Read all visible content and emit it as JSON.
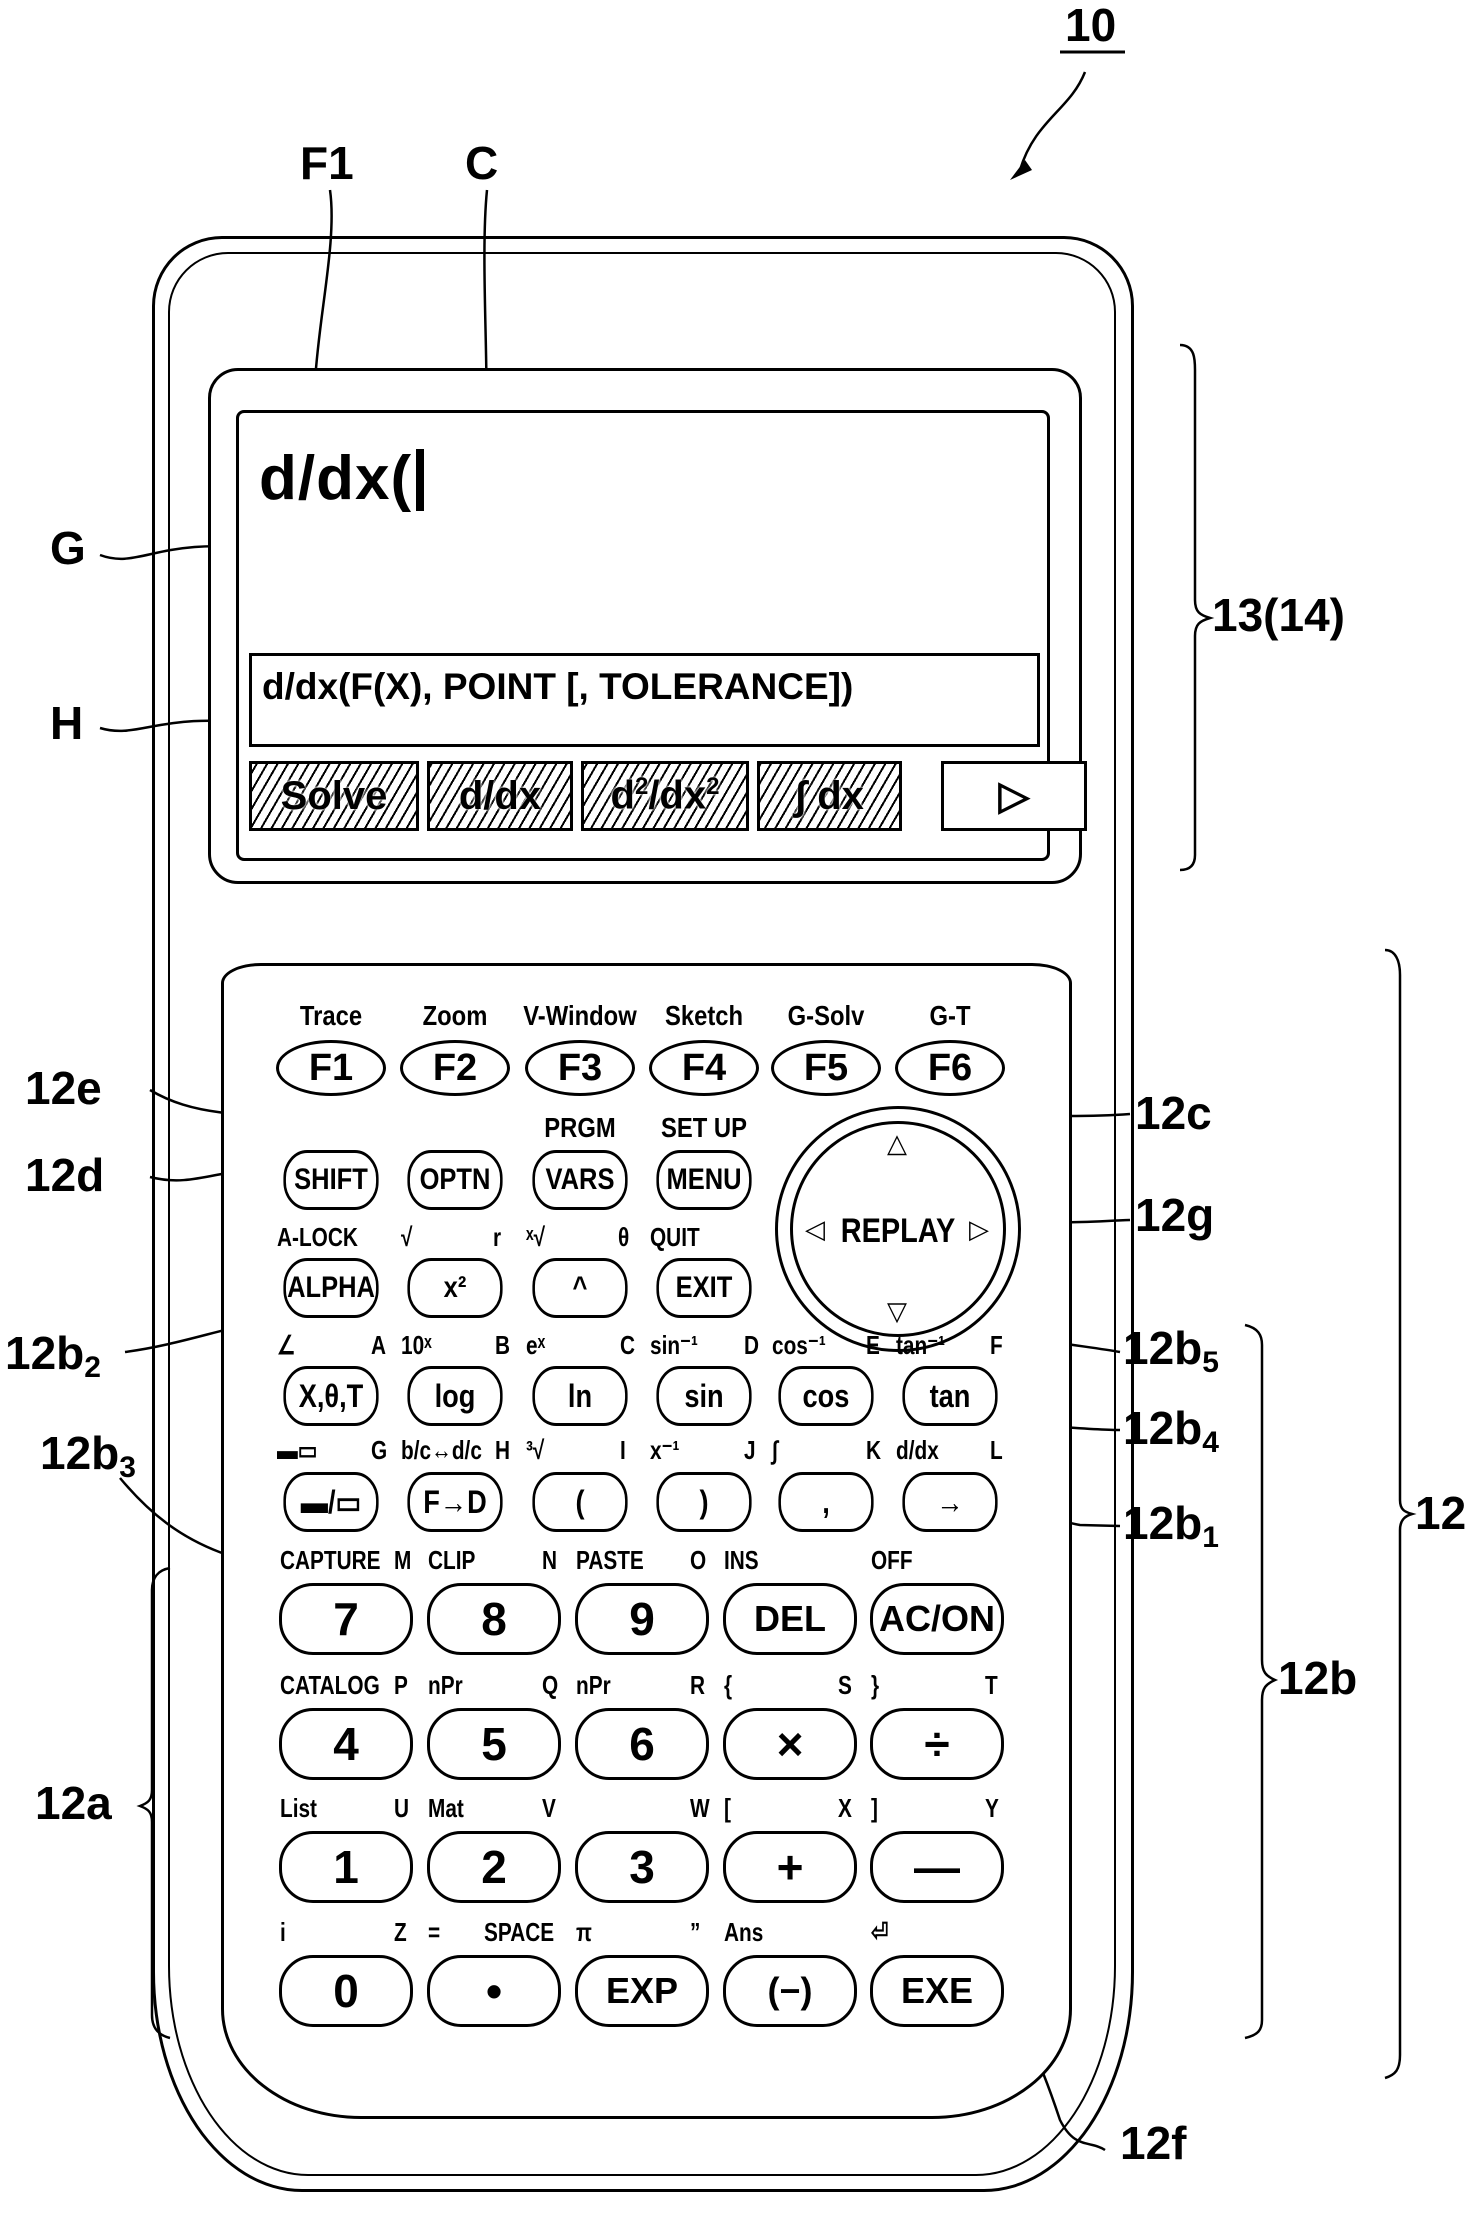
{
  "figure_refs": {
    "device": "10",
    "f1": "F1",
    "c": "C",
    "g": "G",
    "h": "H",
    "display": "13(14)",
    "keypad": "12",
    "r12a": "12a",
    "r12b": "12b",
    "r12b1": {
      "base": "12b",
      "sub": "1"
    },
    "r12b2": {
      "base": "12b",
      "sub": "2"
    },
    "r12b3": {
      "base": "12b",
      "sub": "3"
    },
    "r12b4": {
      "base": "12b",
      "sub": "4"
    },
    "r12b5": {
      "base": "12b",
      "sub": "5"
    },
    "r12c": "12c",
    "r12d": "12d",
    "r12e": "12e",
    "r12f": "12f",
    "r12g": "12g"
  },
  "screen": {
    "input_text": "d/dx(",
    "help_text": "d/dx(F(X), POINT [, TOLERANCE])",
    "softkeys": [
      {
        "label": "Solve",
        "hatched": true
      },
      {
        "label": "d/dx",
        "hatched": true
      },
      {
        "label_base": "d",
        "label_sup1": "2",
        "label_mid": "/dx",
        "label_sup2": "2",
        "hatched": true
      },
      {
        "label": "∫ dx",
        "hatched": true
      },
      {
        "label": "▷",
        "hatched": false,
        "icon": "play-right-icon"
      }
    ]
  },
  "function_keys": [
    {
      "key": "F1",
      "label": "Trace"
    },
    {
      "key": "F2",
      "label": "Zoom"
    },
    {
      "key": "F3",
      "label": "V-Window"
    },
    {
      "key": "F4",
      "label": "Sketch"
    },
    {
      "key": "F5",
      "label": "G-Solv"
    },
    {
      "key": "F6",
      "label": "G-T"
    }
  ],
  "control_row1": [
    {
      "key": "SHIFT",
      "shift": ""
    },
    {
      "key": "OPTN",
      "shift": ""
    },
    {
      "key": "VARS",
      "shift": "PRGM"
    },
    {
      "key": "MENU",
      "shift": "SET UP"
    }
  ],
  "control_row2": [
    {
      "key": "ALPHA",
      "shift": "A-LOCK",
      "alpha": ""
    },
    {
      "key": "x²",
      "shift": "√",
      "alpha": "r"
    },
    {
      "key": "^",
      "shift": "ˣ√",
      "alpha": "θ"
    },
    {
      "key": "EXIT",
      "shift": "QUIT",
      "alpha": ""
    }
  ],
  "replay": {
    "label": "REPLAY",
    "up": "△",
    "down": "▽",
    "left": "◁",
    "right": "▷"
  },
  "func_row1": [
    {
      "key": "X,θ,T",
      "shift": "∠",
      "alpha": "A"
    },
    {
      "key": "log",
      "shift": "10ˣ",
      "alpha": "B"
    },
    {
      "key": "ln",
      "shift": "eˣ",
      "alpha": "C"
    },
    {
      "key": "sin",
      "shift": "sin⁻¹",
      "alpha": "D"
    },
    {
      "key": "cos",
      "shift": "cos⁻¹",
      "alpha": "E"
    },
    {
      "key": "tan",
      "shift": "tan⁻¹",
      "alpha": "F"
    }
  ],
  "func_row2": [
    {
      "key": "▬/▭",
      "shift": "▬▭",
      "alpha": "G"
    },
    {
      "key": "F→D",
      "shift": "b/c↔d/c",
      "alpha": "H"
    },
    {
      "key": "(",
      "shift": "³√",
      "alpha": "I"
    },
    {
      "key": ")",
      "shift": "x⁻¹",
      "alpha": "J"
    },
    {
      "key": ",",
      "shift": "∫",
      "alpha": "K"
    },
    {
      "key": "→",
      "shift": "d/dx",
      "alpha": "L"
    }
  ],
  "num_rows": [
    [
      {
        "key": "7",
        "shift": "CAPTURE",
        "alpha": "M"
      },
      {
        "key": "8",
        "shift": "CLIP",
        "alpha": "N"
      },
      {
        "key": "9",
        "shift": "PASTE",
        "alpha": "O"
      },
      {
        "key": "DEL",
        "shift": "INS",
        "alpha": ""
      },
      {
        "key": "AC/ON",
        "shift": "OFF",
        "alpha": ""
      }
    ],
    [
      {
        "key": "4",
        "shift": "CATALOG",
        "alpha": "P"
      },
      {
        "key": "5",
        "shift": "nPr",
        "alpha": "Q"
      },
      {
        "key": "6",
        "shift": "nPr",
        "alpha": "R"
      },
      {
        "key": "×",
        "shift": "{",
        "alpha": "S"
      },
      {
        "key": "÷",
        "shift": "}",
        "alpha": "T"
      }
    ],
    [
      {
        "key": "1",
        "shift": "List",
        "alpha": "U"
      },
      {
        "key": "2",
        "shift": "Mat",
        "alpha": "V"
      },
      {
        "key": "3",
        "shift": "",
        "alpha": "W"
      },
      {
        "key": "+",
        "shift": "[",
        "alpha": "X"
      },
      {
        "key": "—",
        "shift": "]",
        "alpha": "Y"
      }
    ],
    [
      {
        "key": "0",
        "shift": "i",
        "alpha": "Z"
      },
      {
        "key": "•",
        "shift": "=",
        "alpha": "SPACE"
      },
      {
        "key": "EXP",
        "shift": "π",
        "alpha": "”"
      },
      {
        "key": "(−)",
        "shift": "Ans",
        "alpha": ""
      },
      {
        "key": "EXE",
        "shift": "⏎",
        "alpha": ""
      }
    ]
  ]
}
